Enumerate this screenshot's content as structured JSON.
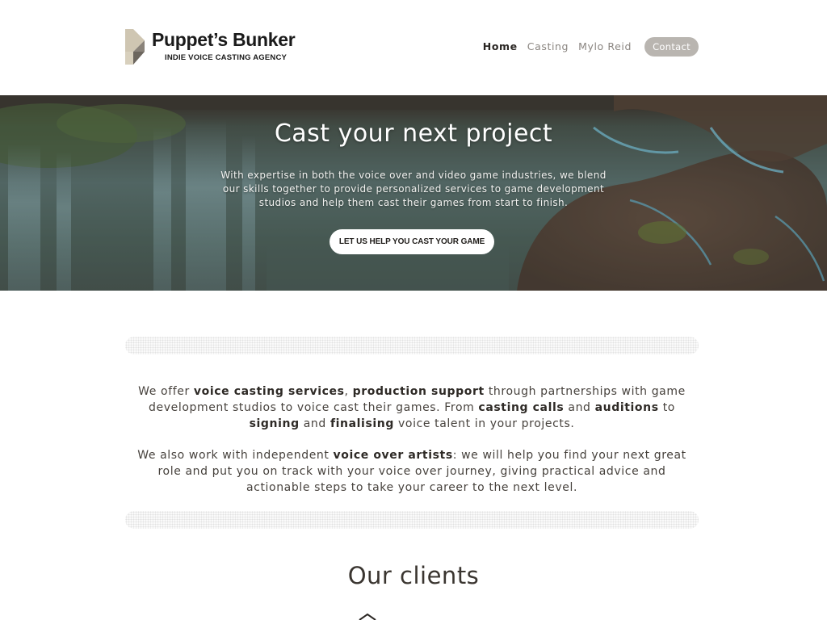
{
  "brand": {
    "name": "Puppet’s Bunker",
    "tagline": "INDIE VOICE CASTING AGENCY"
  },
  "nav": {
    "items": [
      {
        "label": "Home",
        "active": true
      },
      {
        "label": "Casting",
        "active": false
      },
      {
        "label": "Mylo Reid",
        "active": false
      }
    ],
    "contact_label": "Contact"
  },
  "hero": {
    "title": "Cast your next project",
    "text": "With expertise in both the voice over and video game industries, we blend our skills together to provide personalized services to game development studios and help them cast their games from start to finish.",
    "cta_label": "LET US HELP YOU CAST YOUR GAME"
  },
  "intro": {
    "p1": [
      {
        "t": "We offer ",
        "b": false
      },
      {
        "t": "voice casting services",
        "b": true
      },
      {
        "t": ", ",
        "b": false
      },
      {
        "t": "production support",
        "b": true
      },
      {
        "t": " through partnerships with game development studios to voice cast their games. From ",
        "b": false
      },
      {
        "t": "casting calls",
        "b": true
      },
      {
        "t": " and ",
        "b": false
      },
      {
        "t": "auditions",
        "b": true
      },
      {
        "t": " to ",
        "b": false
      },
      {
        "t": "signing",
        "b": true
      },
      {
        "t": " and ",
        "b": false
      },
      {
        "t": "finalising",
        "b": true
      },
      {
        "t": " voice talent in your projects.",
        "b": false
      }
    ],
    "p2": [
      {
        "t": "We also work with independent ",
        "b": false
      },
      {
        "t": "voice over artists",
        "b": true
      },
      {
        "t": ": we will help you find your next great role and put you on track with your voice over journey, giving practical advice and actionable steps to take your career to the next level.",
        "b": false
      }
    ]
  },
  "clients": {
    "title": "Our clients"
  },
  "colors": {
    "logo_light": "#cfc6b2",
    "logo_dark": "#8a837a",
    "contact_bg": "#b9b5b0",
    "text": "#47423d"
  }
}
